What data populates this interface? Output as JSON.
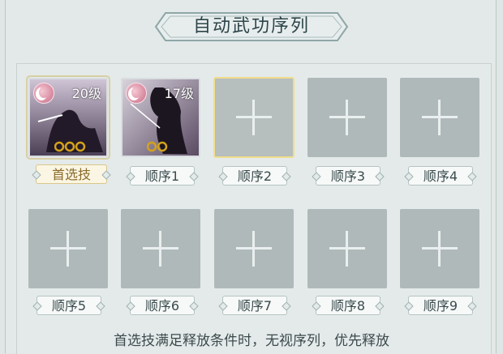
{
  "title": "自动武功序列",
  "slots": [
    {
      "label": "首选技",
      "level": "20级",
      "stars": 3,
      "type": "skill",
      "first": true
    },
    {
      "label": "顺序1",
      "level": "17级",
      "stars": 2,
      "type": "skill"
    },
    {
      "label": "顺序2",
      "type": "empty",
      "selected": true
    },
    {
      "label": "顺序3",
      "type": "empty"
    },
    {
      "label": "顺序4",
      "type": "empty"
    },
    {
      "label": "顺序5",
      "type": "empty"
    },
    {
      "label": "顺序6",
      "type": "empty"
    },
    {
      "label": "顺序7",
      "type": "empty"
    },
    {
      "label": "顺序8",
      "type": "empty"
    },
    {
      "label": "顺序9",
      "type": "empty"
    }
  ],
  "footer": "首选技满足释放条件时，无视序列，优先释放",
  "colors": {
    "empty_slot": "#b0b9b9",
    "selected_outline": "#f0dd8c",
    "accent_gold": "#d4a11c"
  }
}
